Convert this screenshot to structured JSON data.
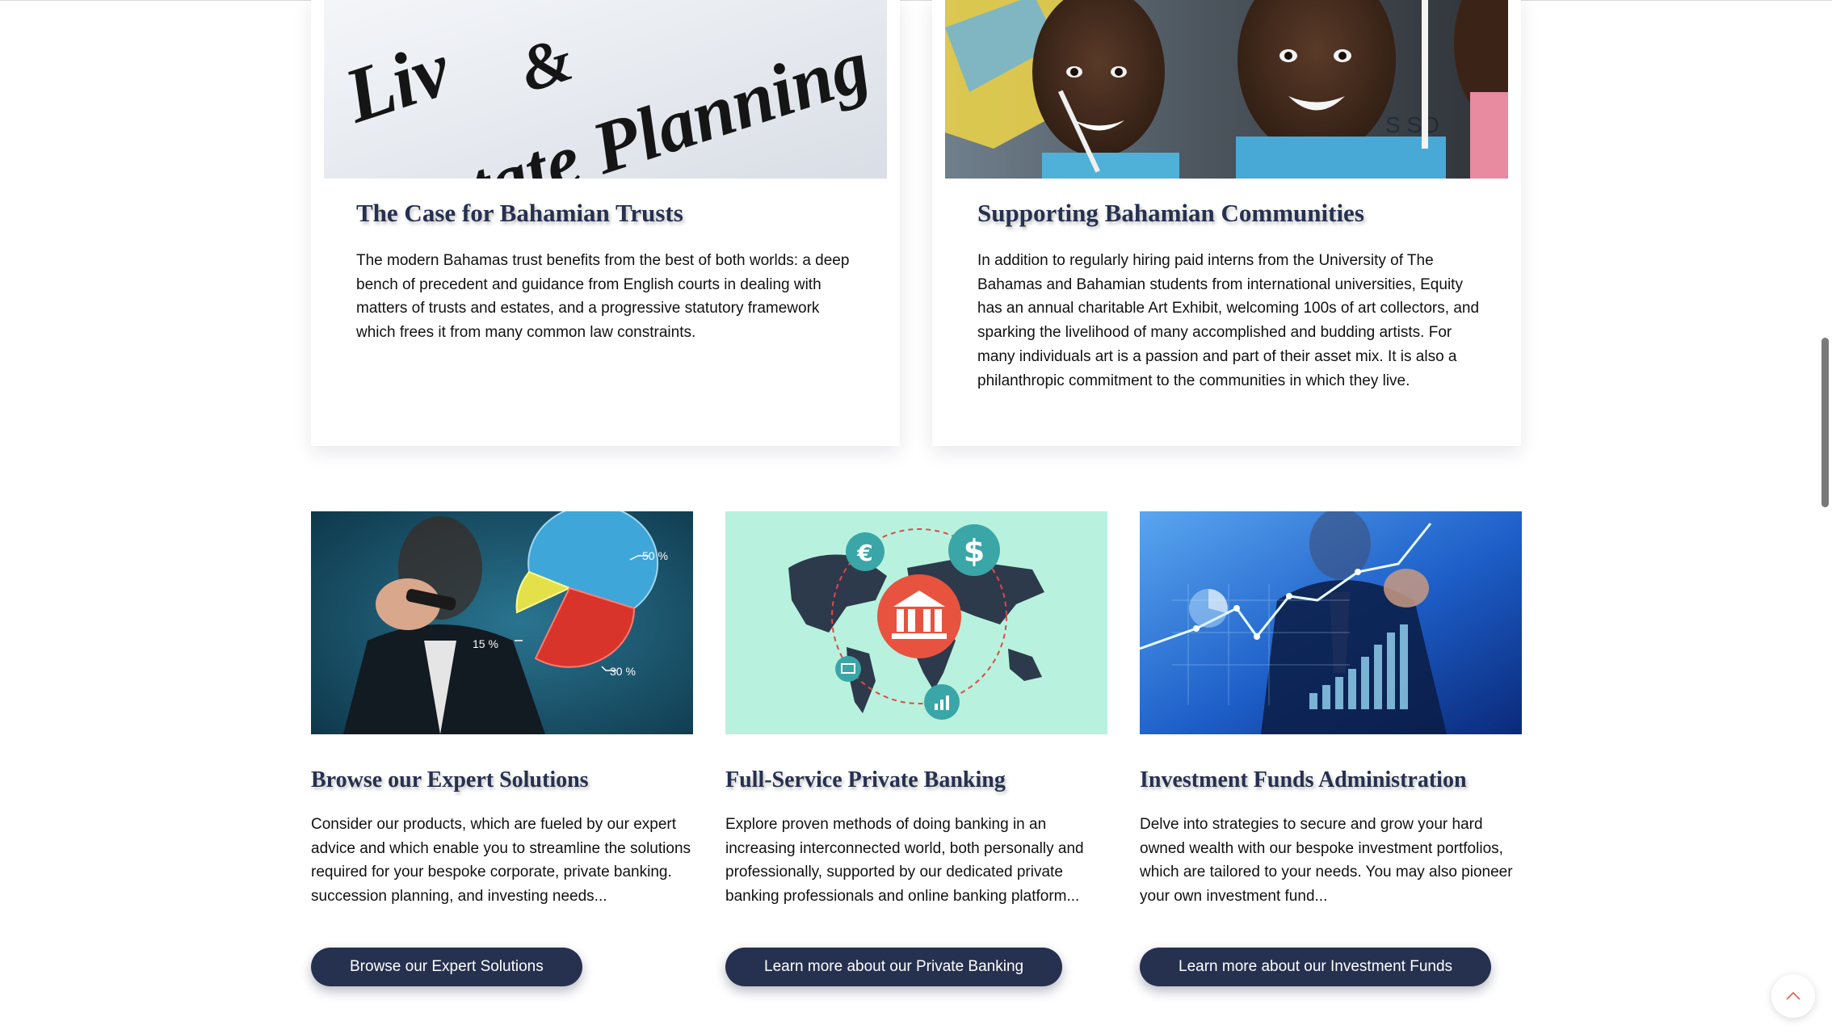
{
  "cards": [
    {
      "title": "The Case for Bahamian Trusts",
      "text": "The modern Bahamas trust benefits from the best of both worlds: a deep bench of precedent and guidance from English courts in dealing with matters of trusts and estates, and a progressive statutory framework which frees it from many common law constraints.",
      "image_text": {
        "line1": "Liv",
        "amp": "&",
        "line2": "tate Planning"
      }
    },
    {
      "title": "Supporting Bahamian Communities",
      "text": "In addition to regularly hiring paid interns from the University of The Bahamas and Bahamian students from international universities, Equity has an annual charitable Art Exhibit, welcoming 100s of art collectors, and sparking the livelihood of many accomplished and budding artists. For many individuals art is a passion and part of their asset mix. It is also a philanthropic commitment to the communities in which they live."
    }
  ],
  "features": [
    {
      "title": "Browse our Expert Solutions",
      "text": "Consider our products, which are fueled by our expert advice and which enable you to streamline the solutions required for your bespoke corporate, private banking. succession planning, and investing needs...",
      "button": "Browse our Expert Solutions",
      "chart_labels": [
        "50 %",
        "15 %",
        "30 %"
      ]
    },
    {
      "title": "Full-Service Private Banking",
      "text": "Explore proven methods of doing banking in an increasing interconnected world, both personally and professionally, supported by our dedicated private banking professionals and online banking platform...",
      "button": "Learn more about our Private Banking",
      "icon_labels": [
        "€",
        "$"
      ]
    },
    {
      "title": "Investment Funds Administration",
      "text": "Delve into strategies to secure and grow your hard owned wealth with our bespoke investment portfolios, which are tailored to your needs. You may also pioneer your own investment fund...",
      "button": "Learn more about our Investment Funds"
    }
  ],
  "ui": {
    "back_to_top_icon": "chevron-up-icon",
    "accent_color": "#26304f",
    "back_to_top_color": "#e0604a"
  }
}
